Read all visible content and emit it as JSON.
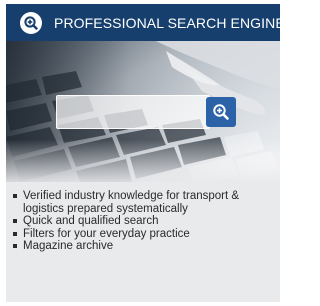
{
  "header": {
    "title": "PROFESSIONAL SEARCH ENGINE",
    "icon": "search-plus-icon"
  },
  "hero": {
    "description_icon": "search-plus-icon",
    "accent": "#2c63a8"
  },
  "features": [
    "Verified industry knowledge for transport & logistics prepared systematically",
    "Quick and qualified search",
    "Filters for your everyday practice",
    "Magazine archive"
  ],
  "colors": {
    "header_bg": "#173f6e",
    "card_bg": "#e9eaec",
    "text": "#2a2a2a"
  }
}
